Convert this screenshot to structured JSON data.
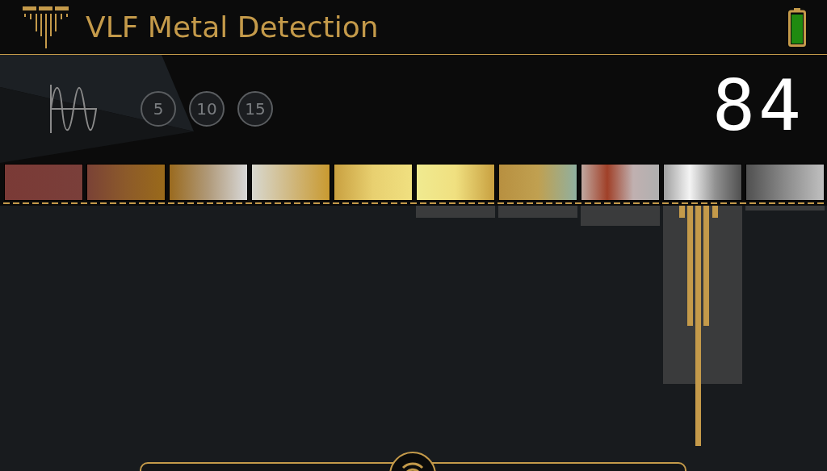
{
  "header": {
    "title": "VLF Metal Detection"
  },
  "filters": [
    {
      "label": "5",
      "selected": false
    },
    {
      "label": "10",
      "selected": false
    },
    {
      "label": "15",
      "selected": false
    }
  ],
  "reading": "84"
}
